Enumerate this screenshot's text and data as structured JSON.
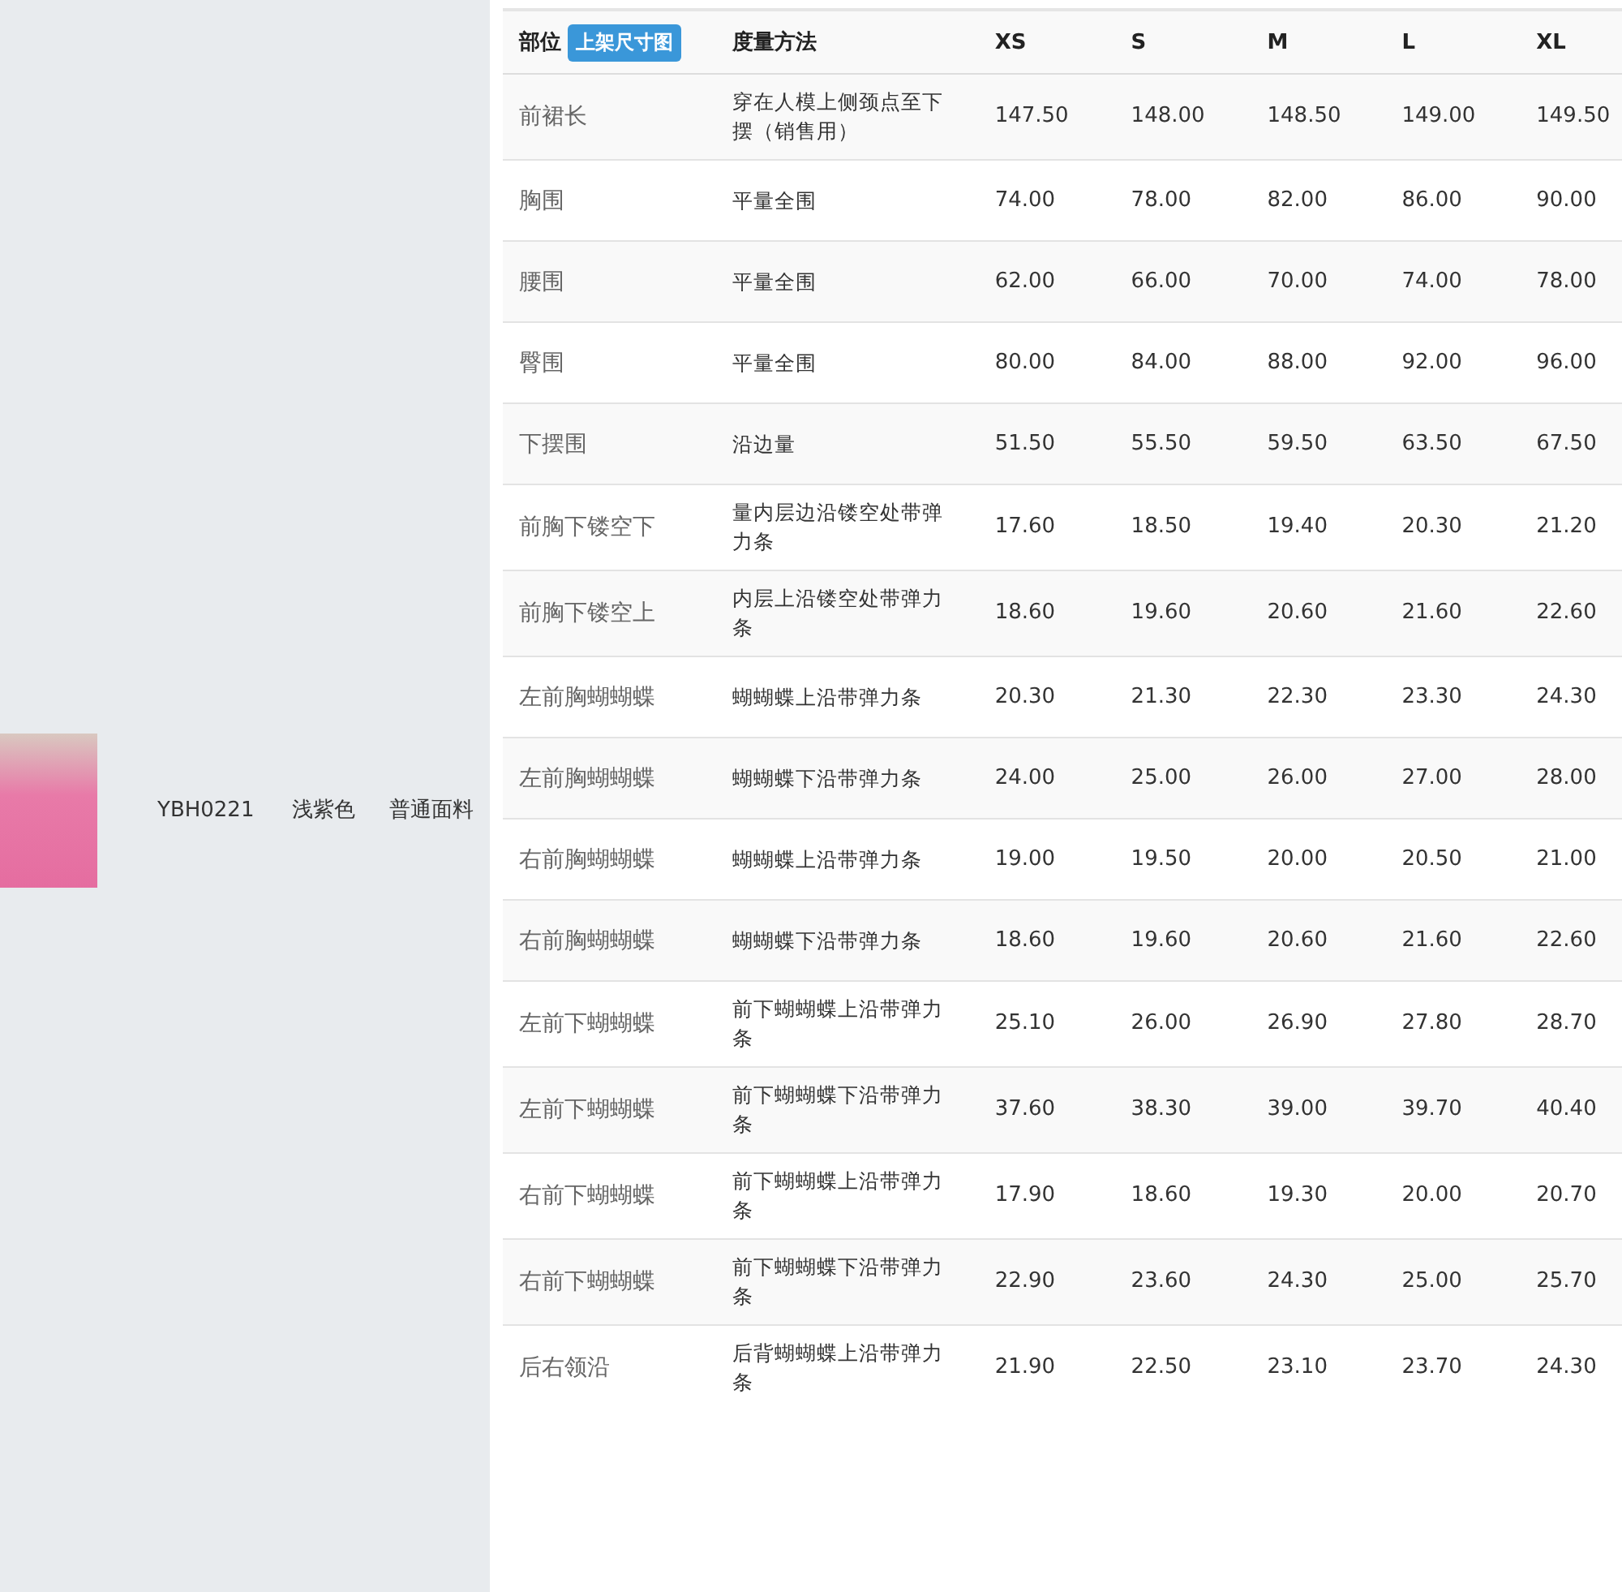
{
  "product": {
    "code": "YBH0221",
    "color_name": "浅紫色",
    "fabric": "普通面料"
  },
  "table": {
    "columns": [
      {
        "label": "部位",
        "badge": "上架尺寸图"
      },
      {
        "label": "度量方法"
      },
      {
        "label": "XS"
      },
      {
        "label": "S"
      },
      {
        "label": "M"
      },
      {
        "label": "L"
      },
      {
        "label": "XL"
      }
    ],
    "rows": [
      [
        "前裙长",
        "穿在人模上侧颈点至下摆（销售用）",
        "147.50",
        "148.00",
        "148.50",
        "149.00",
        "149.50"
      ],
      [
        "胸围",
        "平量全围",
        "74.00",
        "78.00",
        "82.00",
        "86.00",
        "90.00"
      ],
      [
        "腰围",
        "平量全围",
        "62.00",
        "66.00",
        "70.00",
        "74.00",
        "78.00"
      ],
      [
        "臀围",
        "平量全围",
        "80.00",
        "84.00",
        "88.00",
        "92.00",
        "96.00"
      ],
      [
        "下摆围",
        "沿边量",
        "51.50",
        "55.50",
        "59.50",
        "63.50",
        "67.50"
      ],
      [
        "前胸下镂空下",
        "量内层边沿镂空处带弹力条",
        "17.60",
        "18.50",
        "19.40",
        "20.30",
        "21.20"
      ],
      [
        "前胸下镂空上",
        "内层上沿镂空处带弹力条",
        "18.60",
        "19.60",
        "20.60",
        "21.60",
        "22.60"
      ],
      [
        "左前胸蝴蝴蝶",
        "蝴蝴蝶上沿带弹力条",
        "20.30",
        "21.30",
        "22.30",
        "23.30",
        "24.30"
      ],
      [
        "左前胸蝴蝴蝶",
        "蝴蝴蝶下沿带弹力条",
        "24.00",
        "25.00",
        "26.00",
        "27.00",
        "28.00"
      ],
      [
        "右前胸蝴蝴蝶",
        "蝴蝴蝶上沿带弹力条",
        "19.00",
        "19.50",
        "20.00",
        "20.50",
        "21.00"
      ],
      [
        "右前胸蝴蝴蝶",
        "蝴蝴蝶下沿带弹力条",
        "18.60",
        "19.60",
        "20.60",
        "21.60",
        "22.60"
      ],
      [
        "左前下蝴蝴蝶",
        "前下蝴蝴蝶上沿带弹力条",
        "25.10",
        "26.00",
        "26.90",
        "27.80",
        "28.70"
      ],
      [
        "左前下蝴蝴蝶",
        "前下蝴蝴蝶下沿带弹力条",
        "37.60",
        "38.30",
        "39.00",
        "39.70",
        "40.40"
      ],
      [
        "右前下蝴蝴蝶",
        "前下蝴蝴蝶上沿带弹力条",
        "17.90",
        "18.60",
        "19.30",
        "20.00",
        "20.70"
      ],
      [
        "右前下蝴蝴蝶",
        "前下蝴蝴蝶下沿带弹力条",
        "22.90",
        "23.60",
        "24.30",
        "25.00",
        "25.70"
      ],
      [
        "后右领沿",
        "后背蝴蝴蝶上沿带弹力条",
        "21.90",
        "22.50",
        "23.10",
        "23.70",
        "24.30"
      ]
    ]
  }
}
